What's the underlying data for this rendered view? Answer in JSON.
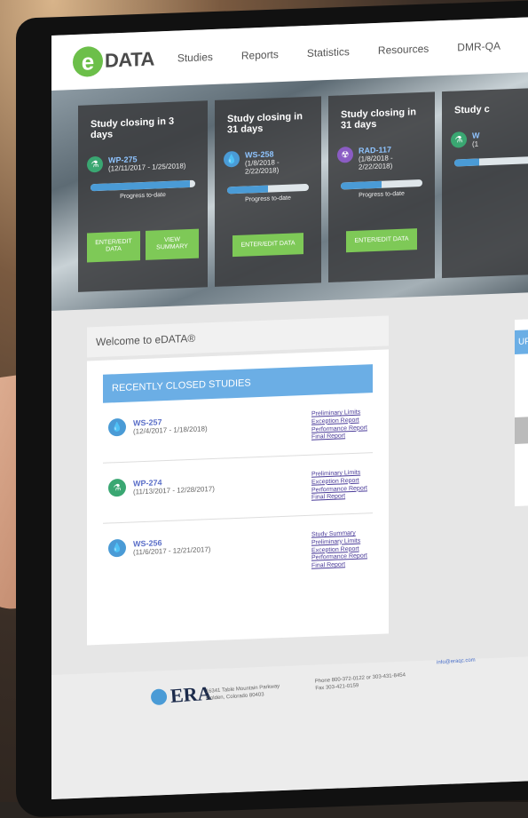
{
  "nav": {
    "logo_e": "e",
    "logo_text": "DATA",
    "items": [
      "Studies",
      "Reports",
      "Statistics",
      "Resources",
      "DMR-QA"
    ]
  },
  "cards": [
    {
      "title": "Study closing in 3 days",
      "code": "WP-275",
      "dates": "(12/11/2017 - 1/25/2018)",
      "icon": "flask-icon",
      "progress": 0.95,
      "progress_label": "Progress to-date",
      "buttons": [
        "ENTER/EDIT DATA",
        "VIEW SUMMARY"
      ]
    },
    {
      "title": "Study closing in 31 days",
      "code": "WS-258",
      "dates": "(1/8/2018 - 2/22/2018)",
      "icon": "water-drop-icon",
      "progress": 0.5,
      "progress_label": "Progress to-date",
      "buttons": [
        "ENTER/EDIT DATA"
      ]
    },
    {
      "title": "Study closing in 31 days",
      "code": "RAD-117",
      "dates": "(1/8/2018 - 2/22/2018)",
      "icon": "radiation-icon",
      "progress": 0.5,
      "progress_label": "Progress to-date",
      "buttons": [
        "ENTER/EDIT DATA"
      ]
    },
    {
      "title": "Study c",
      "code": "W",
      "dates": "(1",
      "icon": "flask-icon",
      "progress": 0.3,
      "progress_label": "",
      "buttons": []
    }
  ],
  "welcome": "Welcome to eDATA®",
  "recent": {
    "heading": "RECENTLY CLOSED STUDIES",
    "items": [
      {
        "code": "WS-257",
        "dates": "(12/4/2017 - 1/18/2018)",
        "icon": "water-drop-icon",
        "links": [
          "Preliminary Limits",
          "Exception Report",
          "Performance Report",
          "Final Report"
        ]
      },
      {
        "code": "WP-274",
        "dates": "(11/13/2017 - 12/28/2017)",
        "icon": "flask-icon",
        "links": [
          "Preliminary Limits",
          "Exception Report",
          "Performance Report",
          "Final Report"
        ]
      },
      {
        "code": "WS-256",
        "dates": "(11/6/2017 - 12/21/2017)",
        "icon": "water-drop-icon",
        "links": [
          "Study Summary",
          "Preliminary Limits",
          "Exception Report",
          "Performance Report",
          "Final Report"
        ]
      }
    ]
  },
  "side_heading": "UP",
  "footer": {
    "era": "ERA",
    "address1": "16341 Table Mountain Parkway",
    "address2": "Golden, Colorado 80403",
    "phone": "Phone 800-372-0122 or 303-431-8454",
    "fax": "Fax 303-421-0159",
    "email": "info@eraqc.com"
  },
  "colors": {
    "accent": "#6baee5",
    "button": "#7ec957",
    "logo": "#6cbf4a"
  }
}
